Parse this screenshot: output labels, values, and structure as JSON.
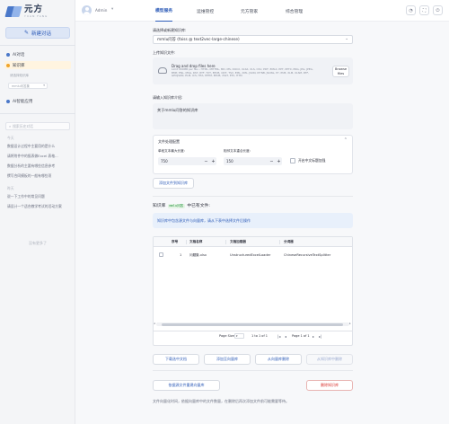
{
  "brand": {
    "name": "元方",
    "subtitle": "YUAN FANG"
  },
  "sidebar": {
    "new_chat": "新建对话",
    "items": [
      {
        "label": "AI对话",
        "color": "#4a78c9"
      },
      {
        "label": "知识库",
        "color": "#f0a52b"
      },
      {
        "label": "AI智能应用",
        "color": "#4a78c9"
      }
    ],
    "sub_label": "请选择知识库",
    "sub_select": "mmlu问答集",
    "history_search": "搜索历史对话",
    "sections": [
      {
        "title": "今天",
        "items": [
          "数据设计过程中主要用的是什么",
          "请将附件中的报表做Excel 表格...",
          "数据分析的主要有哪些信息参考",
          "撰写合同模板的一般有哪些项"
        ]
      },
      {
        "title": "昨天",
        "items": [
          "说一下工作中的常见问题",
          "请设计一个适合教学考试的活动方案"
        ]
      }
    ],
    "footer": "没有更多了"
  },
  "topbar": {
    "username": "Admin",
    "tabs": [
      "模型服务",
      "运维管控",
      "元方管家",
      "综合管理"
    ],
    "active_tab": 0,
    "icons": [
      "bell-icon",
      "fullscreen-icon",
      "logout-icon"
    ]
  },
  "form": {
    "select_kb_label": "请选择或新建知识库:",
    "select_kb_value": "mmlu问答 (faiss @ text2vec-large-chinese)",
    "upload_label": "上传知识文件:",
    "upload_title": "Drag and drop files here",
    "upload_desc": "Limit 200MB per file • HTML, MHTML, MD, MS, DOCX, XLSX, XLS, CSV, PDF, EMLX, PPT, PPTX, PNG, JPG, JPEG, BMP, ENL, MSG, RST, RTF, TXT, EPUB, ODT, TSV, EML, XML, JSON, IPYNB, JSONL, PY, PUB, XLM, XLSM, RTF, GEOJSON, ELM, ICS, HTA, PPTM, EPUB, XSLT, ETC, HTM",
    "browse_label": "Browse files",
    "intro_label": "请输入知识库介绍:",
    "intro_value": "关于mmlu问答的知识库",
    "config_title": "文件处理配置",
    "chunk_size_label": "单段文本最大长度:",
    "chunk_size_value": "750",
    "overlap_label": "相邻文本重合长度:",
    "overlap_value": "150",
    "zh_title_label": "开启中文标题加强",
    "add_files_button": "添加文件到知识库"
  },
  "kb": {
    "title_prefix": "知识库",
    "title_code": "mmlu问答",
    "title_suffix": "中已有文件:",
    "info": "知识库中包含源文件与向量库，请从下表中选择文件后操作",
    "columns": [
      "序号",
      "文档名称",
      "文档加载器",
      "分词器"
    ],
    "rows": [
      {
        "index": "1",
        "name": "问题集.xlsx",
        "loader": "UnstructuredExcelLoader",
        "splitter": "ChineseRecursiveTextSplitter"
      }
    ],
    "page_size_label": "Page Size:",
    "range": "1 to 1 of 1",
    "page": "Page 1 of 1"
  },
  "actions": {
    "download": "下载选中文档",
    "add_to_vector": "添加至向量库",
    "delete_from_vector": "从向量库删除",
    "delete_from_kb": "从知识库中删除",
    "rebuild": "依据源文件重建向量库",
    "delete_kb": "删除知识库"
  },
  "footnote": "文件向量化时间，依据向量库中的文件数量，在删除后再次添加文件前可能需要等待。"
}
